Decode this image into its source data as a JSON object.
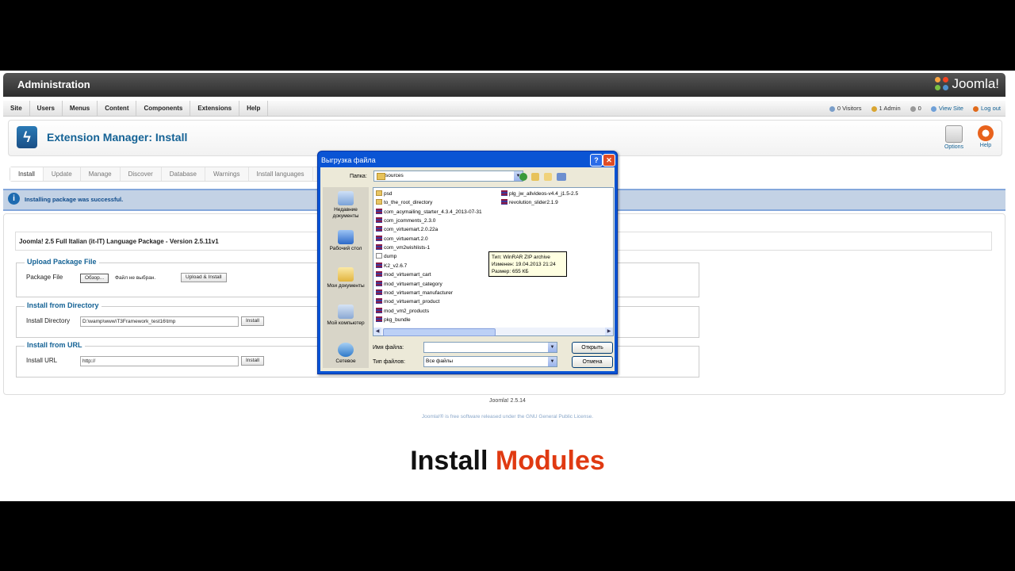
{
  "admin": {
    "title": "Administration",
    "brand": "Joomla!",
    "menu": [
      "Site",
      "Users",
      "Menus",
      "Content",
      "Components",
      "Extensions",
      "Help"
    ],
    "status": {
      "visitors": "0 Visitors",
      "admin": "1 Admin",
      "messages": "0",
      "view_site": "View Site",
      "logout": "Log out"
    }
  },
  "toolbar": {
    "title": "Extension Manager: Install",
    "options_label": "Options",
    "help_label": "Help"
  },
  "tabs": [
    "Install",
    "Update",
    "Manage",
    "Discover",
    "Database",
    "Warnings",
    "Install languages"
  ],
  "message": "Installing package was successful.",
  "package_name": "Joomla! 2.5 Full Italian (it-IT) Language Package - Version 2.5.11v1",
  "upload": {
    "legend": "Upload Package File",
    "label": "Package File",
    "browse": "Обзор...",
    "no_file": "Файл не выбран.",
    "button": "Upload & Install"
  },
  "directory": {
    "legend": "Install from Directory",
    "label": "Install Directory",
    "value": "D:\\wamp\\www\\T3Framework_test16\\tmp",
    "button": "Install"
  },
  "url": {
    "legend": "Install from URL",
    "label": "Install URL",
    "value": "http://",
    "button": "Install"
  },
  "footer": {
    "version": "Joomla! 2.5.14",
    "license": "Joomla!® is free software released under the GNU General Public License."
  },
  "caption": {
    "part1": "Install",
    "part2": "Modules"
  },
  "dialog": {
    "title": "Выгрузка файла",
    "lookin_label": "Папка:",
    "lookin_value": "sources",
    "places": [
      "Недавние документы",
      "Рабочий стол",
      "Мои документы",
      "Мой компьютер",
      "Сетевое"
    ],
    "files_col1": [
      {
        "name": "psd",
        "type": "folder"
      },
      {
        "name": "to_the_root_directory",
        "type": "folder"
      },
      {
        "name": "com_acymailing_starter_4.3.4_2013-07-31",
        "type": "zip"
      },
      {
        "name": "com_jcomments_2.3.0",
        "type": "zip"
      },
      {
        "name": "com_virtuemart.2.0.22a",
        "type": "zip"
      },
      {
        "name": "com_virtuemart.2.0",
        "type": "zip"
      },
      {
        "name": "com_vm2wishlists-1",
        "type": "zip"
      },
      {
        "name": "dump",
        "type": "file"
      },
      {
        "name": "K2_v2.6.7",
        "type": "zip"
      },
      {
        "name": "mod_virtuemart_cart",
        "type": "zip"
      },
      {
        "name": "mod_virtuemart_category",
        "type": "zip"
      },
      {
        "name": "mod_virtuemart_manufacturer",
        "type": "zip"
      },
      {
        "name": "mod_virtuemart_product",
        "type": "zip"
      },
      {
        "name": "mod_vm2_products",
        "type": "zip"
      },
      {
        "name": "pkg_bundle",
        "type": "zip"
      }
    ],
    "files_col2": [
      {
        "name": "plg_jw_allvideos-v4.4_j1.5-2.5",
        "type": "zip"
      },
      {
        "name": "revolution_slider2.1.9",
        "type": "zip"
      }
    ],
    "tooltip": [
      "Тип: WinRAR ZIP archive",
      "Изменен: 19.04.2013 21:24",
      "Размер: 655 КБ"
    ],
    "filename_label": "Имя файла:",
    "filename_value": "",
    "filetype_label": "Тип файлов:",
    "filetype_value": "Все файлы",
    "open_button": "Открыть",
    "cancel_button": "Отмена"
  },
  "colors": {
    "accent": "#146295",
    "caption_accent": "#e03a12",
    "dialog_blue": "#0a54d4"
  }
}
